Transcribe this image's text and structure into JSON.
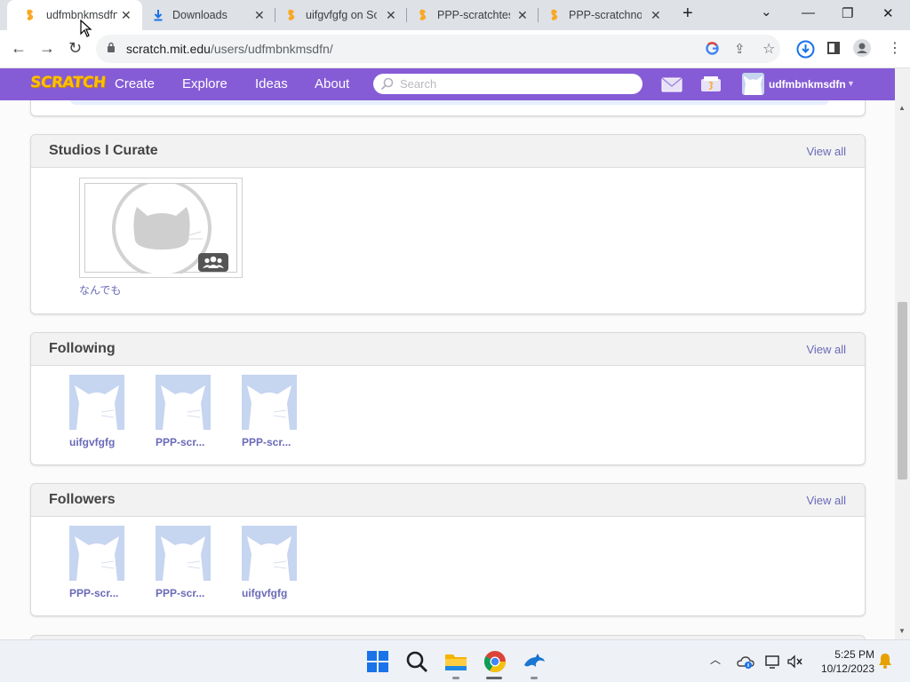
{
  "browser": {
    "tabs": [
      {
        "title": "udfmbnkmsdfn",
        "active": true
      },
      {
        "title": "Downloads",
        "active": false
      },
      {
        "title": "uifgvfgfg on Sc",
        "active": false
      },
      {
        "title": "PPP-scratchtes",
        "active": false
      },
      {
        "title": "PPP-scratchnol",
        "active": false
      }
    ],
    "new_tab": "+",
    "window": {
      "dropdown": "⌄",
      "minimize": "—",
      "restore": "❐",
      "close": "✕"
    },
    "url_host": "scratch.mit.edu",
    "url_path": "/users/udfmbnkmsdfn/"
  },
  "scratch_nav": {
    "logo": "SCRATCH",
    "links": [
      "Create",
      "Explore",
      "Ideas",
      "About"
    ],
    "search_placeholder": "Search",
    "username": "udfmbnkmsdfn",
    "accent": "#855cd6"
  },
  "sections": {
    "studios": {
      "title": "Studios I Curate",
      "view_all": "View all",
      "items": [
        {
          "title": "なんでも"
        }
      ]
    },
    "following": {
      "title": "Following",
      "view_all": "View all",
      "users": [
        "uifgvfgfg",
        "PPP-scr...",
        "PPP-scr..."
      ]
    },
    "followers": {
      "title": "Followers",
      "view_all": "View all",
      "users": [
        "PPP-scr...",
        "PPP-scr...",
        "uifgvfgfg"
      ]
    }
  },
  "taskbar": {
    "apps": [
      "windows-start",
      "search",
      "file-explorer",
      "chrome",
      "dolphin-app"
    ],
    "time": "5:25 PM",
    "date": "10/12/2023"
  }
}
